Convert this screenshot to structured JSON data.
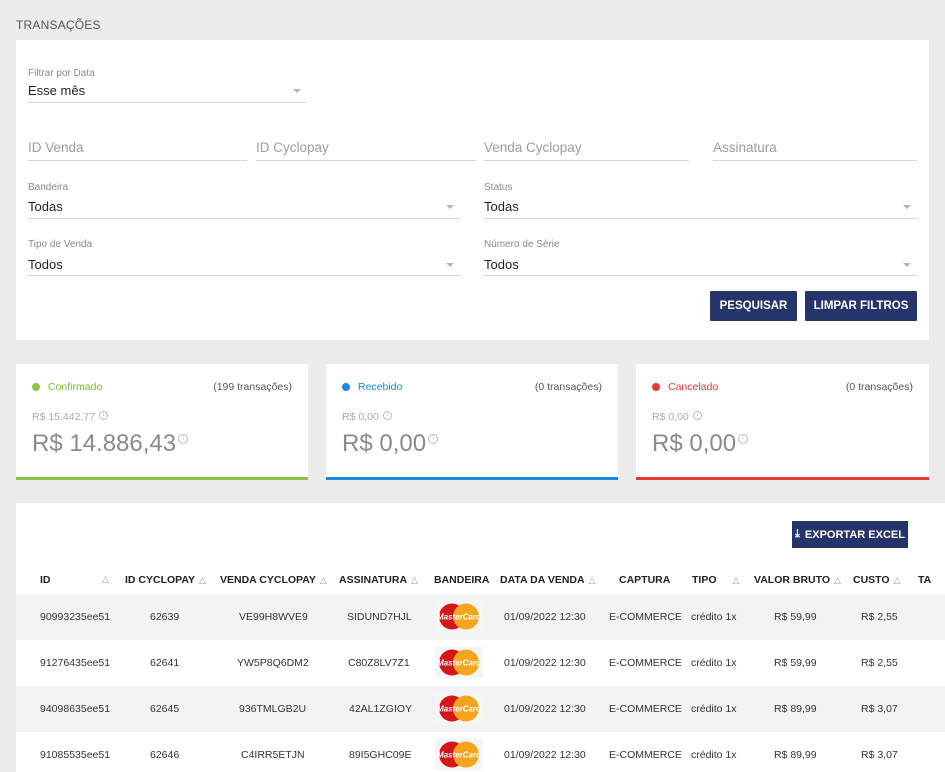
{
  "page": {
    "title": "TRANSAÇÕES"
  },
  "filters": {
    "date": {
      "label": "Filtrar por Data",
      "value": "Esse mês"
    },
    "id_venda": {
      "placeholder": "ID Venda"
    },
    "id_cyclopay": {
      "placeholder": "ID Cyclopay"
    },
    "venda_cyclopay": {
      "placeholder": "Venda Cyclopay"
    },
    "assinatura": {
      "placeholder": "Assinatura"
    },
    "bandeira": {
      "label": "Bandeira",
      "value": "Todas"
    },
    "status": {
      "label": "Status",
      "value": "Todas"
    },
    "tipo_venda": {
      "label": "Tipo de Venda",
      "value": "Todos"
    },
    "numero_serie": {
      "label": "Número de Série",
      "value": "Todos"
    },
    "search_label": "PESQUISAR",
    "clear_label": "LIMPAR FILTROS"
  },
  "summary": [
    {
      "status": "Confirmado",
      "count": "(199 transações)",
      "gross": "R$ 15.442,77",
      "net": "R$ 14.886,43",
      "color": "#8bc34a"
    },
    {
      "status": "Recebido",
      "count": "(0 transações)",
      "gross": "R$ 0,00",
      "net": "R$ 0,00",
      "color": "#1e88e5"
    },
    {
      "status": "Cancelado",
      "count": "(0 transações)",
      "gross": "R$ 0,00",
      "net": "R$ 0,00",
      "color": "#e53935"
    }
  ],
  "table": {
    "export_label": "EXPORTAR EXCEL",
    "headers": {
      "id": "ID",
      "id_cyclopay": "ID CYCLOPAY",
      "venda_cyclopay": "VENDA CYCLOPAY",
      "assinatura": "ASSINATURA",
      "bandeira": "BANDEIRA",
      "data_venda": "DATA DA VENDA",
      "captura": "CAPTURA",
      "tipo": "TIPO",
      "valor_bruto": "VALOR BRUTO",
      "custo": "CUSTO",
      "ta": "TA"
    },
    "sort_glyph": "△",
    "brand_text": "MasterCard",
    "rows": [
      {
        "id": "90993235ee51",
        "id_cyclopay": "62639",
        "venda": "VE99H8WVE9",
        "assinatura": "SIDUND7HJL",
        "data": "01/09/2022 12:30",
        "captura": "E-COMMERCE",
        "tipo": "crédito 1x",
        "valor": "R$ 59,99",
        "custo": "R$ 2,55"
      },
      {
        "id": "91276435ee51",
        "id_cyclopay": "62641",
        "venda": "YW5P8Q6DM2",
        "assinatura": "C80Z8LV7Z1",
        "data": "01/09/2022 12:30",
        "captura": "E-COMMERCE",
        "tipo": "crédito 1x",
        "valor": "R$ 59,99",
        "custo": "R$ 2,55"
      },
      {
        "id": "94098635ee51",
        "id_cyclopay": "62645",
        "venda": "936TMLGB2U",
        "assinatura": "42AL1ZGIOY",
        "data": "01/09/2022 12:30",
        "captura": "E-COMMERCE",
        "tipo": "crédito 1x",
        "valor": "R$ 89,99",
        "custo": "R$ 3,07"
      },
      {
        "id": "91085535ee51",
        "id_cyclopay": "62646",
        "venda": "C4IRR5ETJN",
        "assinatura": "89I5GHC09E",
        "data": "01/09/2022 12:30",
        "captura": "E-COMMERCE",
        "tipo": "crédito 1x",
        "valor": "R$ 89,99",
        "custo": "R$ 3,07"
      }
    ]
  }
}
